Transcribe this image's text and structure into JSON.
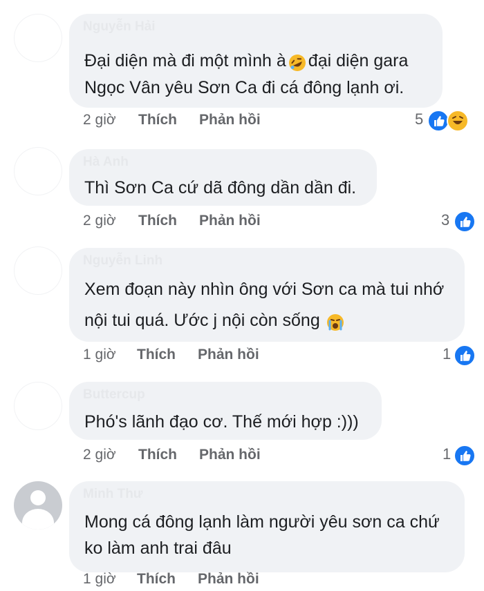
{
  "comments": [
    {
      "name": "Nguyễn Hải",
      "lines": [
        "Đại diện mà đi một mình à",
        "đại diện gara",
        "Ngọc Vân yêu Sơn Ca đi cá đông lạnh ơi."
      ],
      "inline_emoji": "rolling-on-floor-laughing-icon",
      "time": "2 giờ",
      "like_label": "Thích",
      "reply_label": "Phản hồi",
      "reaction_count": "5",
      "reactions": [
        "like-icon",
        "haha-icon"
      ]
    },
    {
      "name": "Hà Anh",
      "lines": [
        "Thì Sơn Ca cứ dã đông dần dần đi."
      ],
      "time": "2 giờ",
      "like_label": "Thích",
      "reply_label": "Phản hồi",
      "reaction_count": "3",
      "reactions": [
        "like-icon"
      ]
    },
    {
      "name": "Nguyễn Linh",
      "lines": [
        "Xem đoạn này nhìn ông với Sơn ca mà tui nhớ",
        "nội tui quá. Ước j nội còn sống"
      ],
      "inline_emoji": "loudly-crying-face-icon",
      "time": "1 giờ",
      "like_label": "Thích",
      "reply_label": "Phản hồi",
      "reaction_count": "1",
      "reactions": [
        "like-icon"
      ]
    },
    {
      "name": "Buttercup",
      "lines": [
        "Phó's lãnh đạo cơ. Thế mới hợp :)))"
      ],
      "time": "2 giờ",
      "like_label": "Thích",
      "reply_label": "Phản hồi",
      "reaction_count": "1",
      "reactions": [
        "like-icon"
      ]
    },
    {
      "name": "Minh Thư",
      "lines": [
        "Mong cá đông lạnh làm người yêu sơn ca chứ",
        "ko làm anh trai đâu"
      ],
      "time": "1 giờ",
      "like_label": "Thích",
      "reply_label": "Phản hồi"
    }
  ],
  "colors": {
    "bubble": "#f0f2f5",
    "text": "#1c1e21",
    "meta": "#65676b",
    "like": "#1877f2",
    "haha": "#f7b928"
  }
}
